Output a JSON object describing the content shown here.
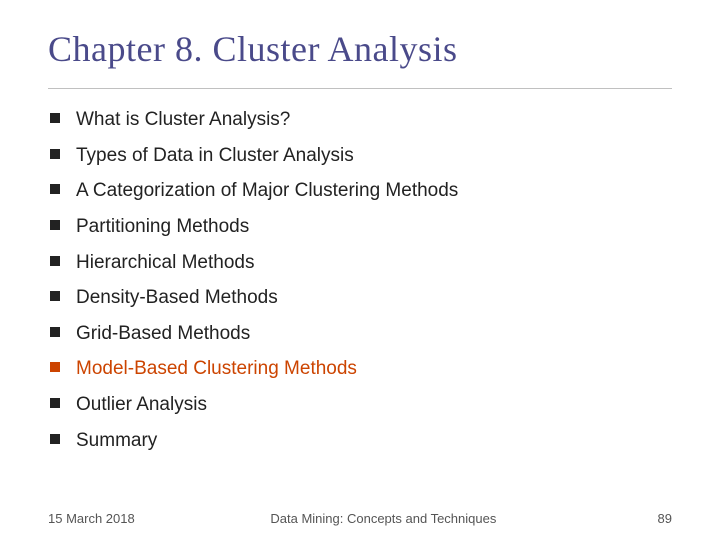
{
  "slide": {
    "title": "Chapter 8.  Cluster Analysis",
    "bullets": [
      {
        "id": 1,
        "text": "What is Cluster Analysis?",
        "highlighted": false
      },
      {
        "id": 2,
        "text": "Types of Data in Cluster Analysis",
        "highlighted": false
      },
      {
        "id": 3,
        "text": "A Categorization of Major Clustering Methods",
        "highlighted": false
      },
      {
        "id": 4,
        "text": "Partitioning Methods",
        "highlighted": false
      },
      {
        "id": 5,
        "text": "Hierarchical Methods",
        "highlighted": false
      },
      {
        "id": 6,
        "text": "Density-Based Methods",
        "highlighted": false
      },
      {
        "id": 7,
        "text": "Grid-Based Methods",
        "highlighted": false
      },
      {
        "id": 8,
        "text": "Model-Based Clustering Methods",
        "highlighted": true
      },
      {
        "id": 9,
        "text": "Outlier Analysis",
        "highlighted": false
      },
      {
        "id": 10,
        "text": "Summary",
        "highlighted": false
      }
    ],
    "footer": {
      "left": "15 March 2018",
      "center": "Data Mining: Concepts and Techniques",
      "right": "89"
    }
  }
}
